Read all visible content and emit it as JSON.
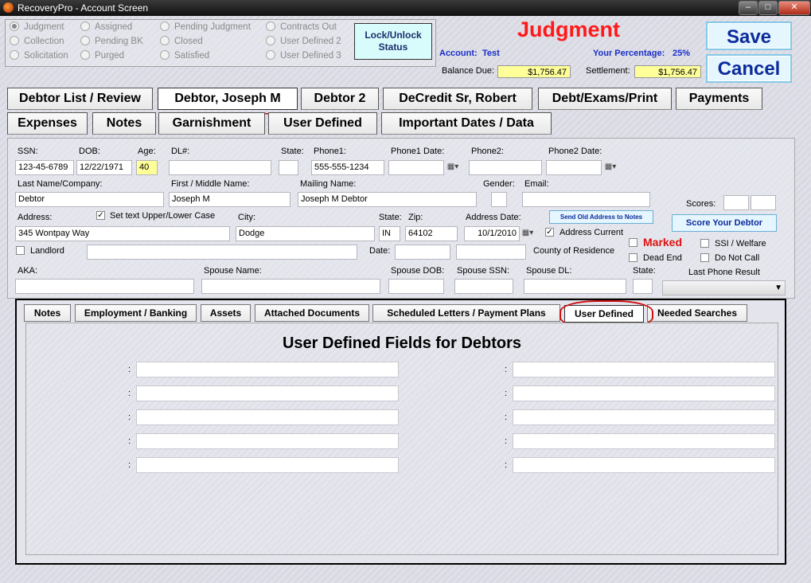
{
  "window": {
    "title": "RecoveryPro - Account Screen"
  },
  "status_options": [
    {
      "label": "Judgment",
      "selected": true
    },
    {
      "label": "Collection",
      "selected": false
    },
    {
      "label": "Solicitation",
      "selected": false
    },
    {
      "label": "Assigned",
      "selected": false
    },
    {
      "label": "Pending BK",
      "selected": false
    },
    {
      "label": "Purged",
      "selected": false
    },
    {
      "label": "Pending Judgment",
      "selected": false
    },
    {
      "label": "Closed",
      "selected": false
    },
    {
      "label": "Satisfied",
      "selected": false
    },
    {
      "label": "Contracts Out",
      "selected": false
    },
    {
      "label": "User Defined 2",
      "selected": false
    },
    {
      "label": "User Defined 3",
      "selected": false
    }
  ],
  "lock_button": {
    "line1": "Lock/Unlock",
    "line2": "Status"
  },
  "header": {
    "status_title": "Judgment",
    "account_label": "Account:",
    "account_value": "Test",
    "your_percentage_label": "Your Percentage:",
    "your_percentage_value": "25%",
    "balance_due_label": "Balance Due:",
    "balance_due_value": "$1,756.47",
    "settlement_label": "Settlement:",
    "settlement_value": "$1,756.47"
  },
  "actions": {
    "save": "Save",
    "cancel": "Cancel"
  },
  "main_tabs": {
    "row1": [
      "Debtor List / Review",
      "Debtor, Joseph M",
      "Debtor 2",
      "DeCredit Sr, Robert",
      "Debt/Exams/Print",
      "Payments"
    ],
    "row2": [
      "Expenses",
      "Notes",
      "Garnishment",
      "User Defined",
      "Important Dates / Data"
    ],
    "active": "Debtor, Joseph M"
  },
  "form": {
    "ssn_label": "SSN:",
    "ssn": "123-45-6789",
    "dob_label": "DOB:",
    "dob": "12/22/1971",
    "age_label": "Age:",
    "age": "40",
    "dl_label": "DL#:",
    "dl": "",
    "state_label": "State:",
    "phone1_label": "Phone1:",
    "phone1": "555-555-1234",
    "phone1_date_label": "Phone1 Date:",
    "phone2_label": "Phone2:",
    "phone2_date_label": "Phone2 Date:",
    "last_name_label": "Last Name/Company:",
    "last_name": "Debtor",
    "first_name_label": "First / Middle Name:",
    "first_name": "Joseph M",
    "mailing_name_label": "Mailing Name:",
    "mailing_name": "Joseph M Debtor",
    "gender_label": "Gender:",
    "email_label": "Email:",
    "scores_label": "Scores:",
    "address_label": "Address:",
    "address": "345 Wontpay Way",
    "set_text_case_label": "Set text Upper/Lower Case",
    "city_label": "City:",
    "city": "Dodge",
    "addr_state_label": "State:",
    "addr_state": "IN",
    "zip_label": "Zip:",
    "zip": "64102",
    "address_date_label": "Address Date:",
    "address_date": "10/1/2010",
    "address_current_label": "Address Current",
    "send_old_address": "Send Old Address to Notes",
    "score_debtor": "Score Your Debtor",
    "landlord_label": "Landlord",
    "date_label": "Date:",
    "county_label": "County of Residence",
    "marked_label": "Marked",
    "dead_end_label": "Dead End",
    "ssi_label": "SSI / Welfare",
    "do_not_call_label": "Do Not Call",
    "aka_label": "AKA:",
    "spouse_name_label": "Spouse Name:",
    "spouse_dob_label": "Spouse DOB:",
    "spouse_ssn_label": "Spouse SSN:",
    "spouse_dl_label": "Spouse DL:",
    "spouse_state_label": "State:",
    "last_phone_result_label": "Last Phone Result"
  },
  "sub_tabs": {
    "items": [
      "Notes",
      "Employment / Banking",
      "Assets",
      "Attached Documents",
      "Scheduled Letters  /  Payment Plans",
      "User Defined",
      "Needed Searches"
    ],
    "active": "User Defined"
  },
  "user_defined": {
    "title": "User Defined Fields for Debtors",
    "colon": ":"
  },
  "colors": {
    "accent_red": "#ff1a1a",
    "button_blue": "#0d2c9b",
    "highlight_yellow": "#ffff99"
  }
}
